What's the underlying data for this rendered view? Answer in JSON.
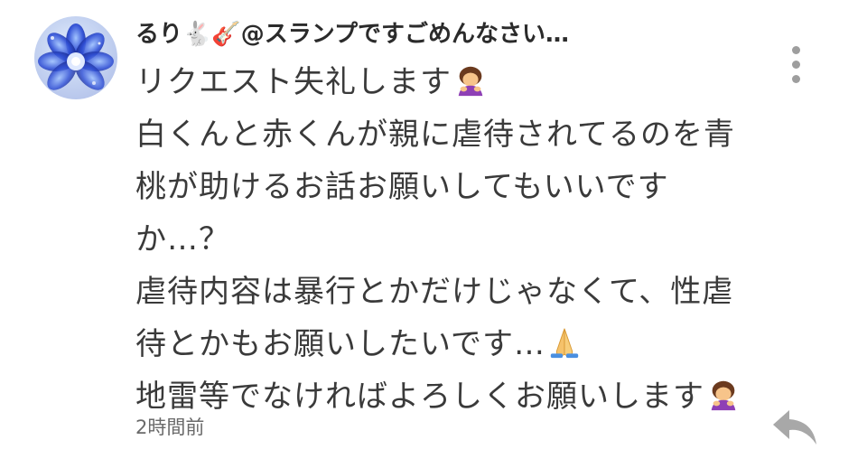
{
  "comment": {
    "username": "るり🐇🎸@スランプですごめんなさい…",
    "lines": [
      "リクエスト失礼します",
      "白くんと赤くんが親に虐待されてるのを青",
      "桃が助けるお話お願いしてもいいです",
      "か…？",
      "虐待内容は暴行とかだけじゃなくて、性虐",
      "待とかもお願いしたいです…",
      "地雷等でなければよろしくお願いします"
    ],
    "timestamp": "2時間前"
  },
  "icons": {
    "avatar": "blue-crystal-flower-avatar",
    "menu": "more-vertical-icon",
    "reply": "reply-arrow-icon",
    "bow_emoji": "bowing-woman-emoji",
    "pray_emoji": "folded-hands-emoji"
  },
  "colors": {
    "text": "#3a3a3a",
    "username": "#2b2b2b",
    "muted": "#9e9e9e",
    "background": "#ffffff"
  }
}
